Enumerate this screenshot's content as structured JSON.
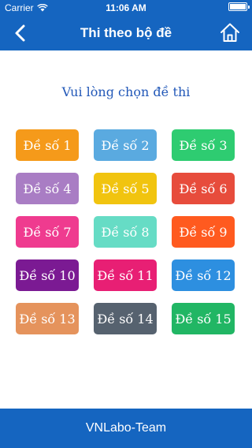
{
  "status_bar": {
    "carrier": "Carrier",
    "time": "11:06 AM"
  },
  "nav": {
    "title": "Thi theo bộ đề",
    "back_icon": "chevron-left-icon",
    "home_icon": "home-icon"
  },
  "prompt": "Vui lòng chọn đề thi",
  "exams": [
    {
      "label": "Đề số 1",
      "color": "#f59a1a"
    },
    {
      "label": "Đề số 2",
      "color": "#5aaae0"
    },
    {
      "label": "Đề số 3",
      "color": "#2ecc71"
    },
    {
      "label": "Đề số 4",
      "color": "#a97dc4"
    },
    {
      "label": "Đề số 5",
      "color": "#f1c40f"
    },
    {
      "label": "Đề số 6",
      "color": "#e74c3c"
    },
    {
      "label": "Đề số 7",
      "color": "#ef3b8f"
    },
    {
      "label": "Đề số 8",
      "color": "#66dcc5"
    },
    {
      "label": "Đề số 9",
      "color": "#ff5a1f"
    },
    {
      "label": "Đề số 10",
      "color": "#7b1a93"
    },
    {
      "label": "Đề số 11",
      "color": "#e81f74"
    },
    {
      "label": "Đề số 12",
      "color": "#2d8fe0"
    },
    {
      "label": "Đề số 13",
      "color": "#e5935c"
    },
    {
      "label": "Đề số 14",
      "color": "#56626f"
    },
    {
      "label": "Đề số 15",
      "color": "#21b664"
    }
  ],
  "footer": "VNLabo-Team"
}
